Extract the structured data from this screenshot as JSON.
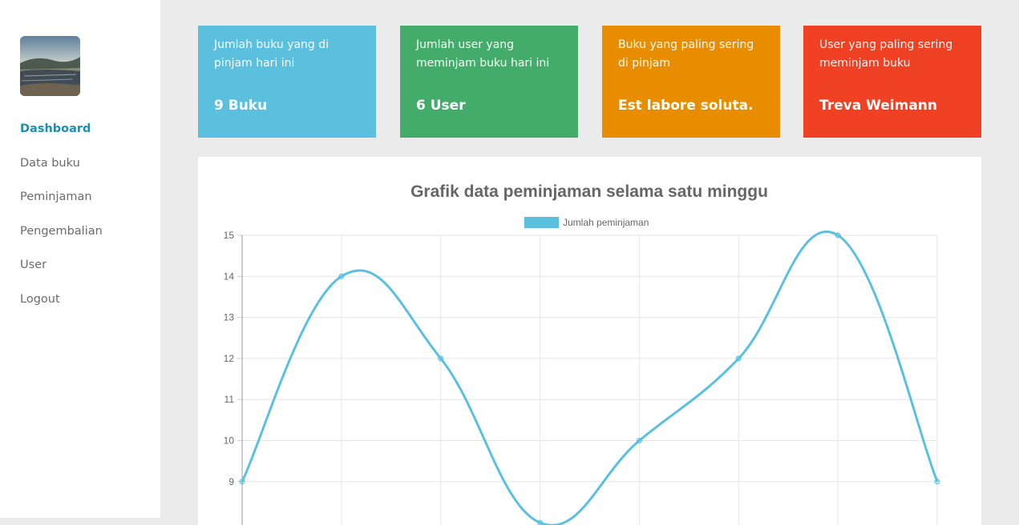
{
  "sidebar": {
    "items": [
      {
        "label": "Dashboard",
        "active": true
      },
      {
        "label": "Data buku",
        "active": false
      },
      {
        "label": "Peminjaman",
        "active": false
      },
      {
        "label": "Pengembalian",
        "active": false
      },
      {
        "label": "User",
        "active": false
      },
      {
        "label": "Logout",
        "active": false
      }
    ]
  },
  "cards": [
    {
      "label": "Jumlah buku yang di pinjam hari ini",
      "value": "9 Buku",
      "color": "#5bc0de"
    },
    {
      "label": "Jumlah user yang meminjam buku hari ini",
      "value": "6 User",
      "color": "#43ac6a"
    },
    {
      "label": "Buku yang paling sering di pinjam",
      "value": "Est labore soluta.",
      "color": "#e88d00"
    },
    {
      "label": "User yang paling sering meminjam buku",
      "value": "Treva Weimann",
      "color": "#f04124"
    }
  ],
  "chart_data": {
    "type": "line",
    "title": "Grafik data peminjaman selama satu minggu",
    "series": [
      {
        "name": "Jumlah peminjaman",
        "color": "#5bc0de",
        "values": [
          9,
          14,
          12,
          8,
          10,
          12,
          15,
          9
        ]
      }
    ],
    "y_ticks": [
      15,
      14,
      13,
      12,
      11,
      10,
      9
    ],
    "ylim": [
      8,
      15
    ],
    "grid": true,
    "legend": "top-center"
  }
}
